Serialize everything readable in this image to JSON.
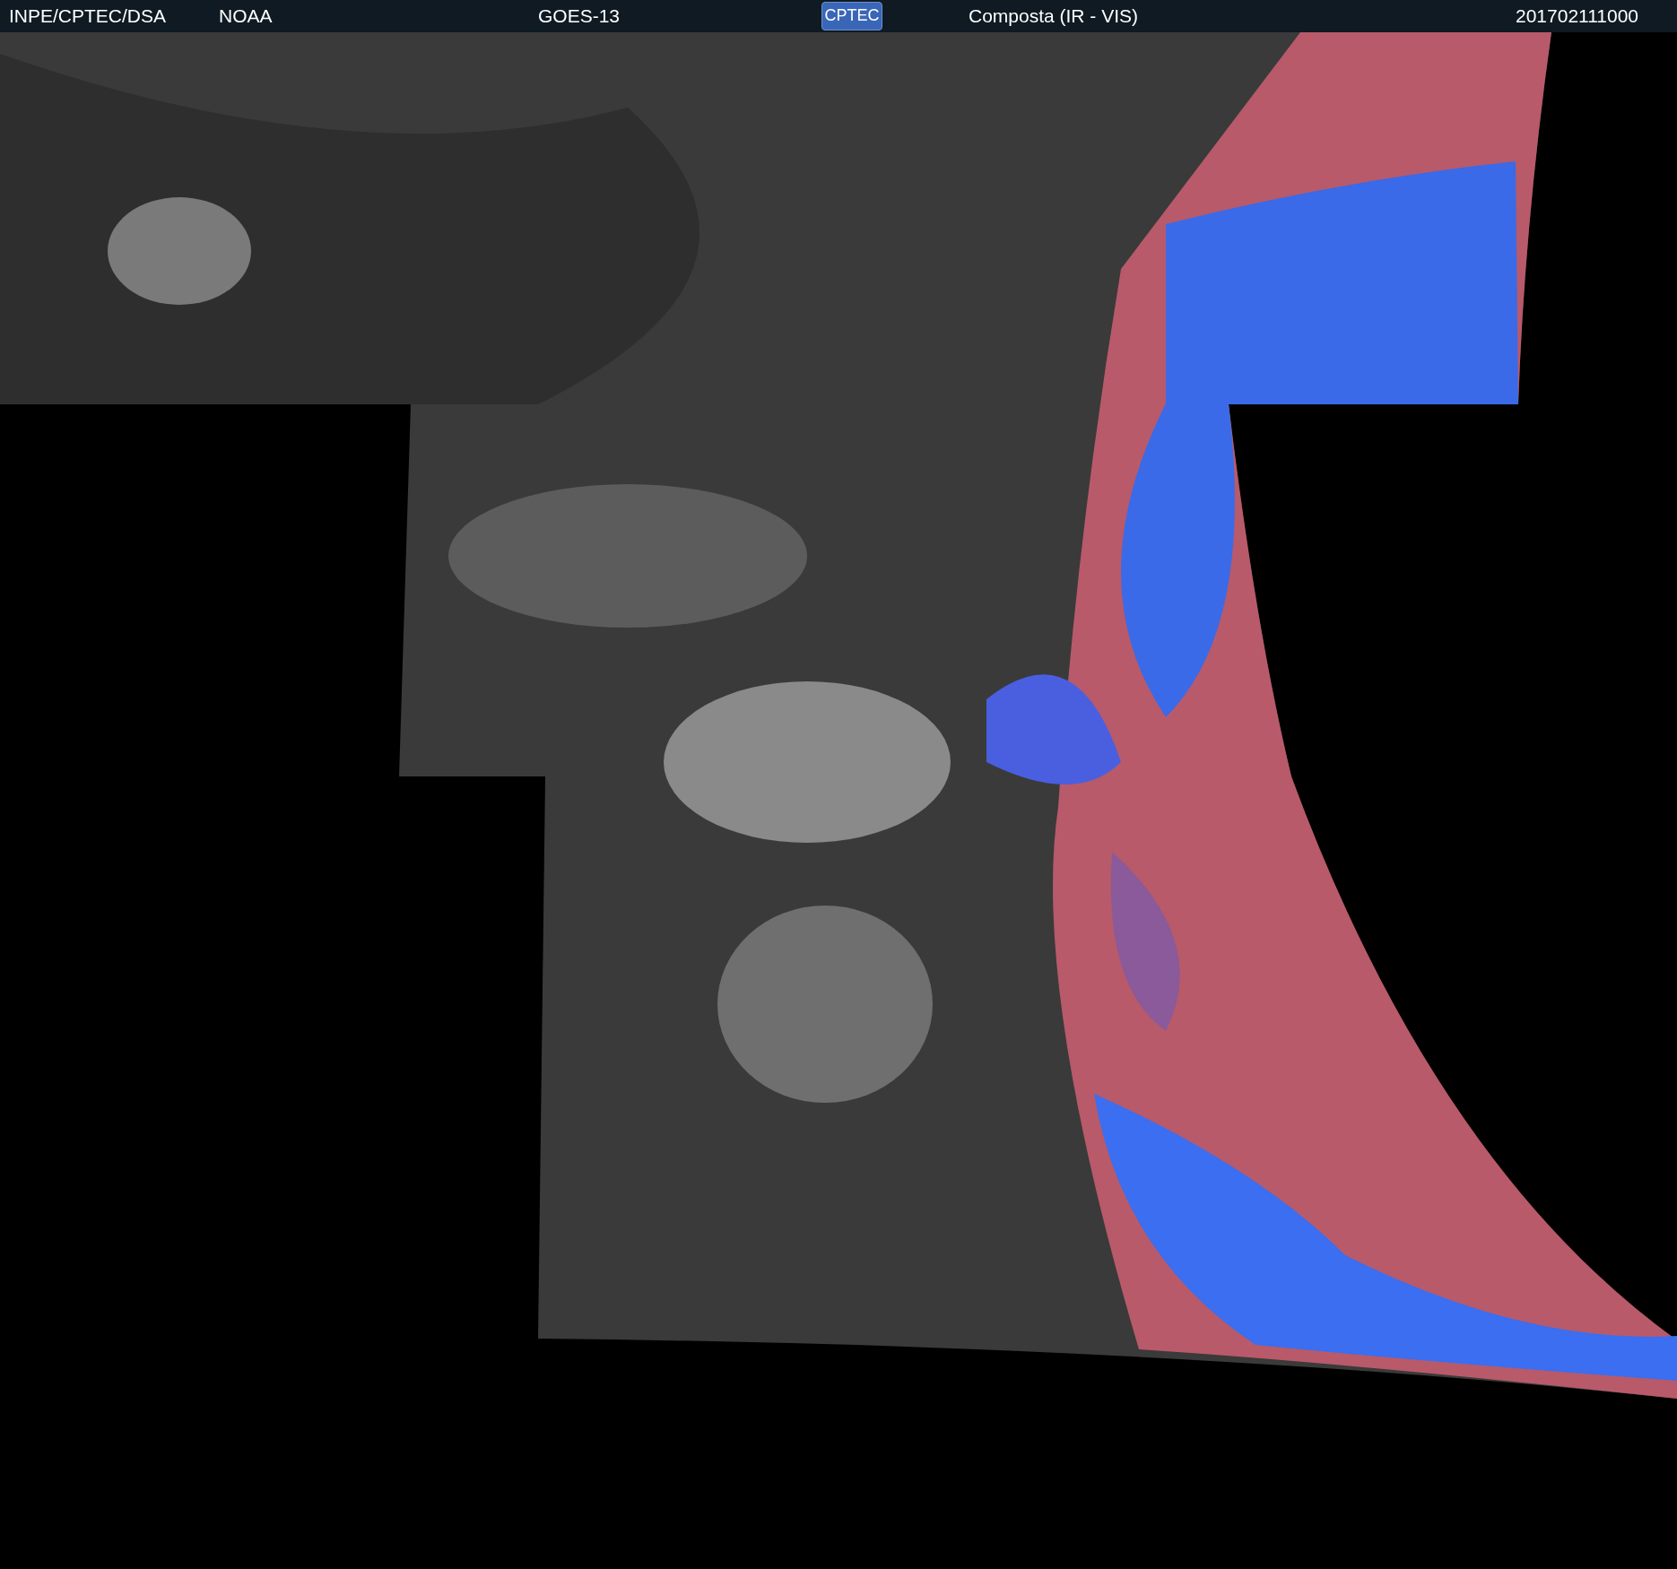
{
  "header": {
    "agency": "INPE/CPTEC/DSA",
    "source": "NOAA",
    "satellite": "GOES-13",
    "logo": "CPTEC",
    "product": "Composta (IR - VIS)",
    "timestamp": "201702111000"
  }
}
